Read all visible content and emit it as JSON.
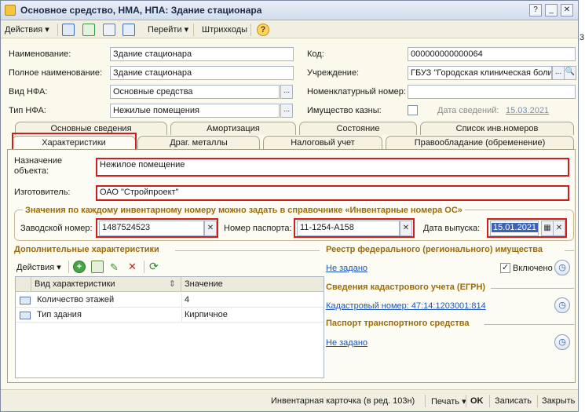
{
  "window": {
    "title": "Основное средство, НМА, НПА: Здание стационара",
    "side_digit": "3"
  },
  "toolbar": {
    "actions": "Действия",
    "goto": "Перейти",
    "barcodes": "Штрихкоды",
    "help": "?"
  },
  "form": {
    "name_label": "Наименование:",
    "name_value": "Здание стационара",
    "fullname_label": "Полное наименование:",
    "fullname_value": "Здание стационара",
    "nfa_kind_label": "Вид НФА:",
    "nfa_kind_value": "Основные средства",
    "nfa_type_label": "Тип НФА:",
    "nfa_type_value": "Нежилые помещения",
    "code_label": "Код:",
    "code_value": "000000000000064",
    "institution_label": "Учреждение:",
    "institution_value": "ГБУЗ \"Городская клиническая боли",
    "nomenclature_label": "Номенклатурный номер:",
    "nomenclature_value": "",
    "treasury_label": "Имущество казны:",
    "info_date_label": "Дата сведений:",
    "info_date_value": "15.03.2021"
  },
  "tabs_row1": [
    {
      "label": "Основные сведения"
    },
    {
      "label": "Амортизация"
    },
    {
      "label": "Состояние"
    },
    {
      "label": "Список инв.номеров"
    }
  ],
  "tabs_row2": [
    {
      "label": "Характеристики"
    },
    {
      "label": "Драг. металлы"
    },
    {
      "label": "Налоговый учет"
    },
    {
      "label": "Правообладание (обременение)"
    }
  ],
  "chars": {
    "purpose_label": "Назначение объекта:",
    "purpose_value": "Нежилое помещение",
    "manufacturer_label": "Изготовитель:",
    "manufacturer_value": "ОАО \"Стройпроект\"",
    "inv_group_title": "Значения по каждому инвентарному номеру можно задать в справочнике «Инвентарные номера ОС»",
    "factory_num_label": "Заводской номер:",
    "factory_num_value": "1487524523",
    "passport_num_label": "Номер паспорта:",
    "passport_num_value": "11-1254-А158",
    "release_date_label": "Дата выпуска:",
    "release_date_value": "15.01.2021"
  },
  "extra": {
    "title": "Дополнительные характеристики",
    "actions": "Действия",
    "col_kind": "Вид характеристики",
    "col_value": "Значение",
    "rows": [
      {
        "kind": "Количество этажей",
        "value": "4"
      },
      {
        "kind": "Тип здания",
        "value": "Кирпичное"
      }
    ]
  },
  "registry": {
    "title": "Реестр федерального (регионального) имущества",
    "value": "Не задано",
    "included_label": "Включено",
    "cadastre_title": "Сведения кадастрового учета (ЕГРН)",
    "cadastre_value": "Кадастровый номер: 47:14:1203001:814",
    "vehicle_title": "Паспорт транспортного средства",
    "vehicle_value": "Не задано"
  },
  "status": {
    "inv_card": "Инвентарная карточка (в ред. 103н)",
    "print": "Печать",
    "ok": "OK",
    "save": "Записать",
    "close": "Закрыть"
  },
  "colors": {
    "accent_red": "#d21d1d",
    "group_title": "#9b6b0c",
    "link": "#1b54b8"
  }
}
